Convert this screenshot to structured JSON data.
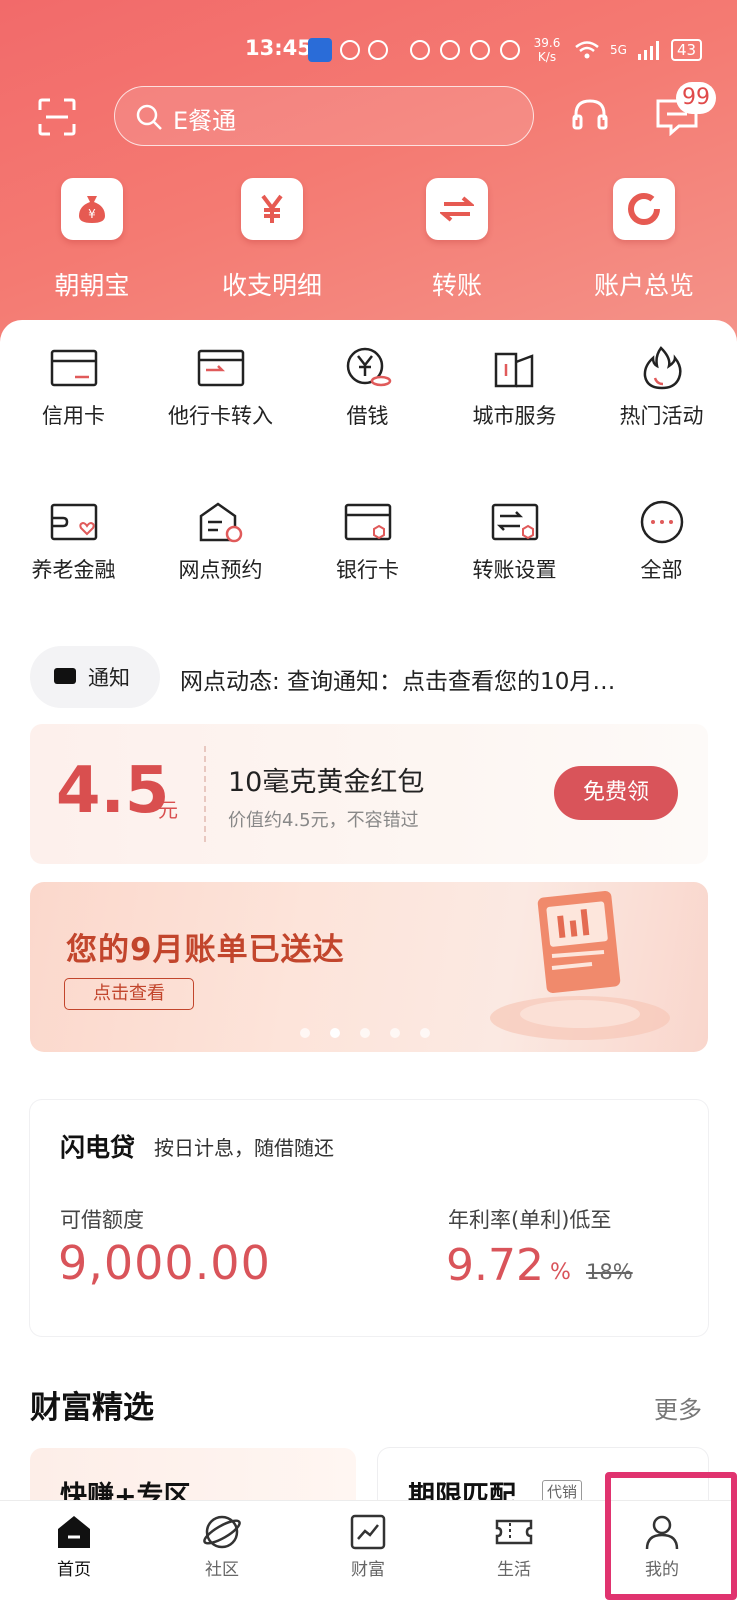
{
  "status_bar": {
    "time": "13:45",
    "speed_top": "39.6",
    "speed_unit": "K/s",
    "network": "5G",
    "battery": "43"
  },
  "header": {
    "search_placeholder": "E餐通",
    "message_badge": "99"
  },
  "quick_actions": [
    {
      "label": "朝朝宝",
      "icon": "money-bag-icon"
    },
    {
      "label": "收支明细",
      "icon": "yuan-icon"
    },
    {
      "label": "转账",
      "icon": "transfer-arrows-icon"
    },
    {
      "label": "账户总览",
      "icon": "ring-chart-icon"
    }
  ],
  "services_row1": [
    {
      "label": "信用卡",
      "icon": "credit-card-icon"
    },
    {
      "label": "他行卡转入",
      "icon": "card-transfer-in-icon"
    },
    {
      "label": "借钱",
      "icon": "borrow-yuan-icon"
    },
    {
      "label": "城市服务",
      "icon": "city-building-icon"
    },
    {
      "label": "热门活动",
      "icon": "flame-icon"
    }
  ],
  "services_row2": [
    {
      "label": "养老金融",
      "icon": "pension-card-icon"
    },
    {
      "label": "网点预约",
      "icon": "branch-booking-icon"
    },
    {
      "label": "银行卡",
      "icon": "bank-card-icon"
    },
    {
      "label": "转账设置",
      "icon": "transfer-settings-icon"
    },
    {
      "label": "全部",
      "icon": "more-dots-icon"
    }
  ],
  "notice": {
    "label": "通知",
    "text": "网点动态: 查询通知：点击查看您的10月…"
  },
  "gold_offer": {
    "amount": "4.5",
    "unit": "元",
    "title": "10毫克黄金红包",
    "subtitle": "价值约4.5元，不容错过",
    "button": "免费领"
  },
  "banner": {
    "headline": "您的9月账单已送达",
    "cta": "点击查看",
    "active_dot": 1,
    "dot_count": 5
  },
  "loan": {
    "name": "闪电贷",
    "desc": "按日计息，随借随还",
    "limit_label": "可借额度",
    "limit_value": "9,000.00",
    "rate_label": "年利率(单利)低至",
    "rate_value": "9.72",
    "rate_unit": "%",
    "rate_old": "18%"
  },
  "wealth": {
    "title": "财富精选",
    "more": "更多",
    "cards": [
      {
        "title": "快赚+专区",
        "tag": ""
      },
      {
        "title": "期限匹配",
        "tag": "代销"
      }
    ]
  },
  "tabs": [
    {
      "label": "首页",
      "icon": "home-icon",
      "active": true
    },
    {
      "label": "社区",
      "icon": "planet-icon",
      "active": false
    },
    {
      "label": "财富",
      "icon": "chart-trend-icon",
      "active": false
    },
    {
      "label": "生活",
      "icon": "ticket-icon",
      "active": false
    },
    {
      "label": "我的",
      "icon": "person-icon",
      "active": false
    }
  ],
  "colors": {
    "brand_red": "#d9545a",
    "hero_gradient_start": "#f26a6a",
    "highlight_border": "#e0336f"
  }
}
